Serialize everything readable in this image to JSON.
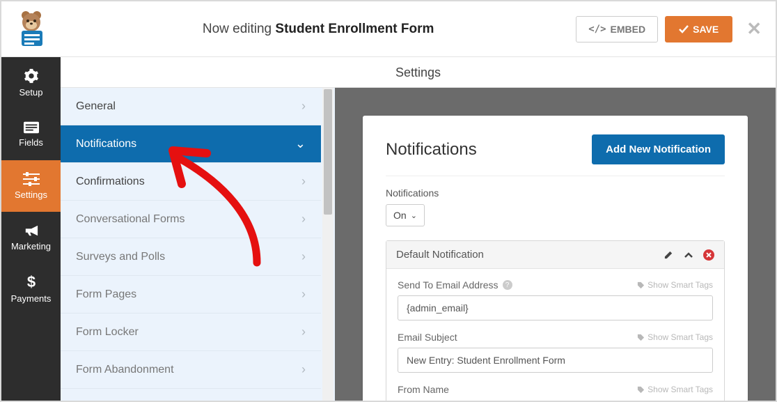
{
  "header": {
    "editing_prefix": "Now editing ",
    "form_name": "Student Enrollment Form",
    "embed_label": "EMBED",
    "save_label": "SAVE"
  },
  "vnav": {
    "setup": "Setup",
    "fields": "Fields",
    "settings": "Settings",
    "marketing": "Marketing",
    "payments": "Payments"
  },
  "page_heading": "Settings",
  "settings_list": {
    "general": "General",
    "notifications": "Notifications",
    "confirmations": "Confirmations",
    "conversational": "Conversational Forms",
    "surveys": "Surveys and Polls",
    "form_pages": "Form Pages",
    "form_locker": "Form Locker",
    "form_abandon": "Form Abandonment"
  },
  "panel": {
    "title": "Notifications",
    "add_btn": "Add New Notification",
    "toggle_label": "Notifications",
    "toggle_value": "On",
    "card_title": "Default Notification",
    "smart_tags": "Show Smart Tags",
    "send_to_label": "Send To Email Address",
    "send_to_value": "{admin_email}",
    "subject_label": "Email Subject",
    "subject_value": "New Entry: Student Enrollment Form",
    "from_name_label": "From Name"
  }
}
